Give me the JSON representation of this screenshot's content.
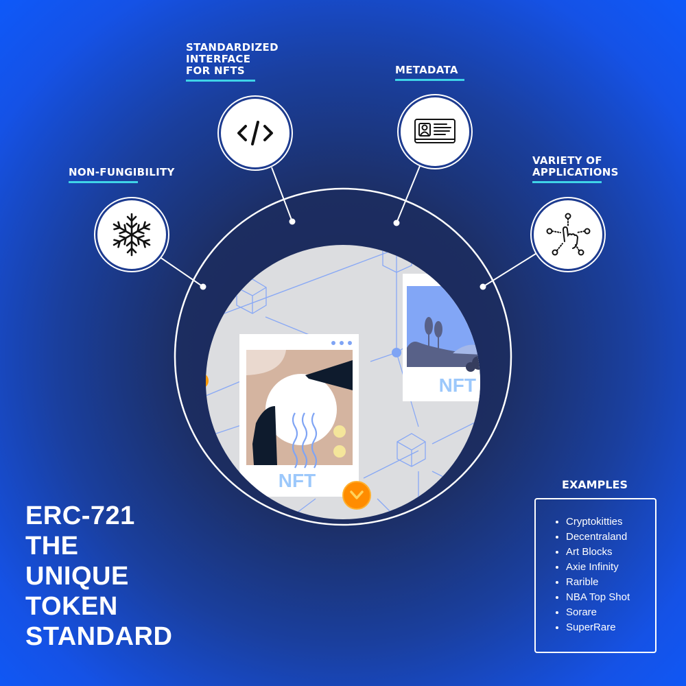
{
  "features": [
    {
      "id": "non-fungibility",
      "label": "NON-FUNGIBILITY",
      "icon": "snowflake-icon"
    },
    {
      "id": "standardized-interface",
      "label": "STANDARDIZED\nINTERFACE\nFOR NFTS",
      "lines": [
        "STANDARDIZED",
        "INTERFACE",
        "FOR NFTS"
      ],
      "icon": "code-icon"
    },
    {
      "id": "metadata",
      "label": "METADATA",
      "icon": "id-card-icon"
    },
    {
      "id": "variety-of-applications",
      "label": "VARIETY OF APPLICATIONS",
      "lines": [
        "VARIETY OF",
        "APPLICATIONS"
      ],
      "icon": "touch-network-icon"
    }
  ],
  "hero": {
    "card1_label": "NFT",
    "card2_label": "NFT"
  },
  "title": {
    "lines": [
      "ERC-721",
      "THE",
      "UNIQUE",
      "TOKEN",
      "STANDARD"
    ]
  },
  "examples": {
    "heading": "EXAMPLES",
    "items": [
      "Cryptokitties",
      "Decentraland",
      "Art Blocks",
      "Axie Infinity",
      "Rarible",
      "NBA Top Shot",
      "Sorare",
      "SuperRare"
    ]
  },
  "colors": {
    "accent_underline": "#3fd4e8",
    "background_blue": "#0c5bff",
    "nft_text": "#9cc8fb",
    "coin_orange": "#ff8c00"
  }
}
